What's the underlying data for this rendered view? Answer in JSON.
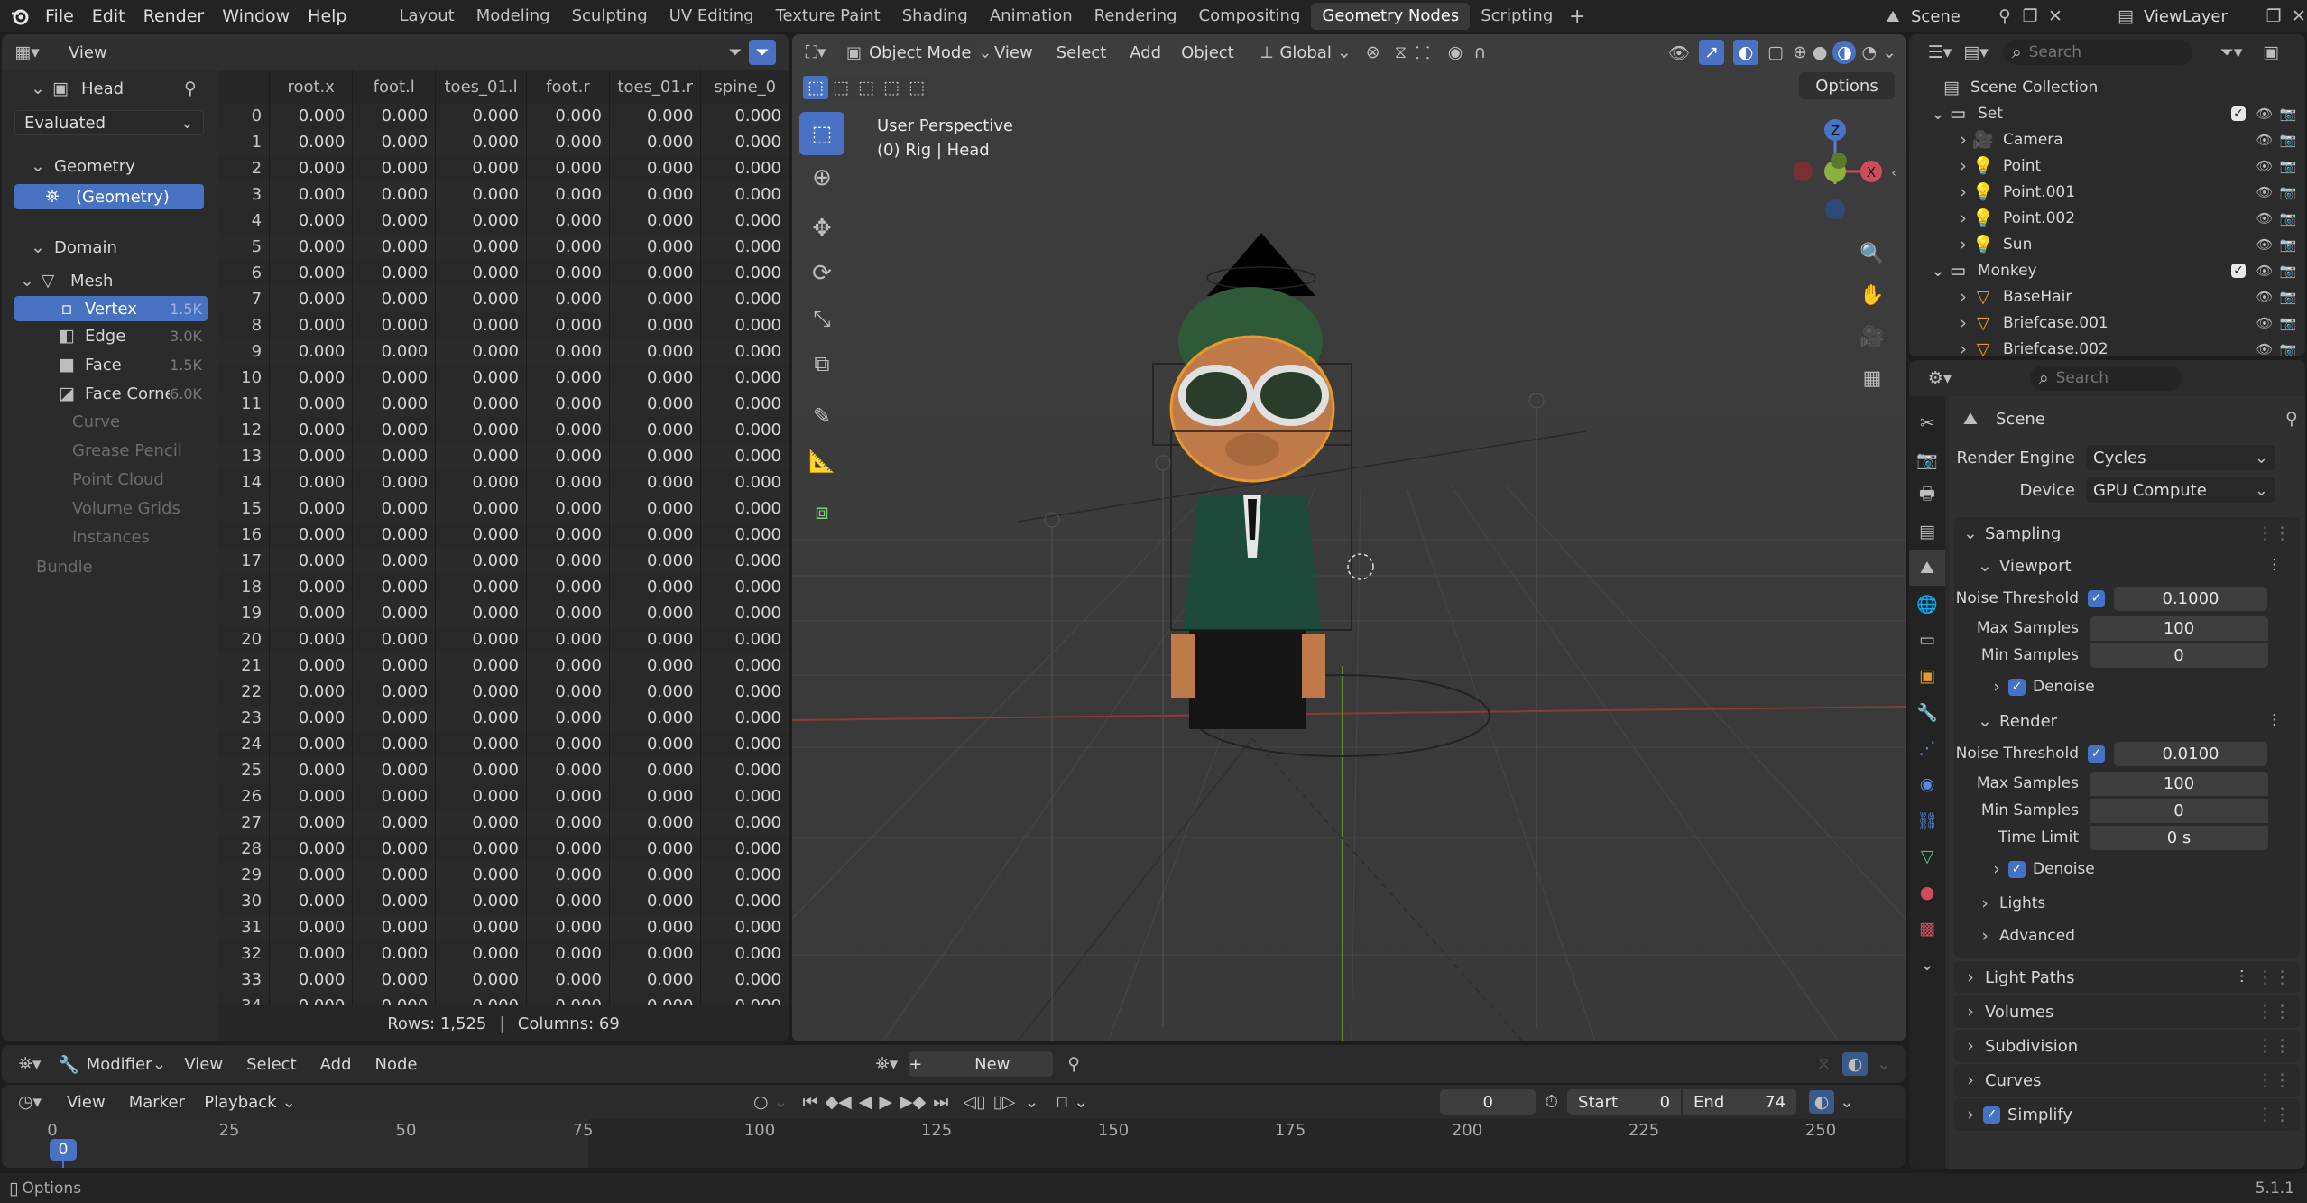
{
  "topbar": {
    "menus": [
      "File",
      "Edit",
      "Render",
      "Window",
      "Help"
    ],
    "workspaces": [
      "Layout",
      "Modeling",
      "Sculpting",
      "UV Editing",
      "Texture Paint",
      "Shading",
      "Animation",
      "Rendering",
      "Compositing",
      "Geometry Nodes",
      "Scripting"
    ],
    "active_workspace": "Geometry Nodes",
    "scene": "Scene",
    "view_layer": "ViewLayer"
  },
  "spreadsheet": {
    "header_view": "View",
    "object_name": "Head",
    "evaluated": "Evaluated",
    "geometry_label": "Geometry",
    "geometry_item": "(Geometry)",
    "domain_label": "Domain",
    "mesh_label": "Mesh",
    "domains": [
      {
        "name": "Vertex",
        "count": "1.5K"
      },
      {
        "name": "Edge",
        "count": "3.0K"
      },
      {
        "name": "Face",
        "count": "1.5K"
      },
      {
        "name": "Face Corner",
        "count": "6.0K"
      }
    ],
    "other_types": [
      "Curve",
      "Grease Pencil",
      "Point Cloud",
      "Volume Grids",
      "Instances"
    ],
    "bundle": "Bundle",
    "columns": [
      "root.x",
      "foot.l",
      "toes_01.l",
      "foot.r",
      "toes_01.r",
      "spine_0"
    ],
    "cell_value": "0.000",
    "row_indices": [
      "0",
      "1",
      "2",
      "3",
      "4",
      "5",
      "6",
      "7",
      "8",
      "9",
      "10",
      "11",
      "12",
      "13",
      "14",
      "15",
      "16",
      "17",
      "18",
      "19",
      "20",
      "21",
      "22",
      "23",
      "24",
      "25",
      "26",
      "27",
      "28",
      "29",
      "30",
      "31",
      "32",
      "33",
      "34"
    ],
    "rows_label": "Rows: 1,525",
    "columns_label": "Columns: 69"
  },
  "viewport": {
    "mode": "Object Mode",
    "menus": [
      "View",
      "Select",
      "Add",
      "Object"
    ],
    "transform": "Global",
    "options": "Options",
    "perspective": "User Perspective",
    "context": "(0) Rig | Head",
    "gizmo_z": "Z",
    "gizmo_x": "X"
  },
  "outliner": {
    "search_placeholder": "Search",
    "root": "Scene Collection",
    "items": [
      {
        "name": "Set",
        "level": 1,
        "type": "collection"
      },
      {
        "name": "Camera",
        "level": 2,
        "type": "camera"
      },
      {
        "name": "Point",
        "level": 2,
        "type": "light"
      },
      {
        "name": "Point.001",
        "level": 2,
        "type": "light"
      },
      {
        "name": "Point.002",
        "level": 2,
        "type": "light"
      },
      {
        "name": "Sun",
        "level": 2,
        "type": "light"
      },
      {
        "name": "Monkey",
        "level": 1,
        "type": "collection"
      },
      {
        "name": "BaseHair",
        "level": 2,
        "type": "mesh"
      },
      {
        "name": "Briefcase.001",
        "level": 2,
        "type": "mesh"
      },
      {
        "name": "Briefcase.002",
        "level": 2,
        "type": "mesh"
      }
    ]
  },
  "properties": {
    "search_placeholder": "Search",
    "scene": "Scene",
    "render_engine_label": "Render Engine",
    "render_engine": "Cycles",
    "device_label": "Device",
    "device": "GPU Compute",
    "sampling": "Sampling",
    "viewport": {
      "title": "Viewport",
      "noise_threshold_label": "Noise Threshold",
      "noise_threshold": "0.1000",
      "max_samples_label": "Max Samples",
      "max_samples": "100",
      "min_samples_label": "Min Samples",
      "min_samples": "0",
      "denoise": "Denoise"
    },
    "render": {
      "title": "Render",
      "noise_threshold_label": "Noise Threshold",
      "noise_threshold": "0.0100",
      "max_samples_label": "Max Samples",
      "max_samples": "100",
      "min_samples_label": "Min Samples",
      "min_samples": "0",
      "time_limit_label": "Time Limit",
      "time_limit": "0 s",
      "denoise": "Denoise"
    },
    "sub_panels": [
      "Lights",
      "Advanced"
    ],
    "panels": [
      "Light Paths",
      "Volumes",
      "Subdivision",
      "Curves",
      "Simplify"
    ]
  },
  "node_editor": {
    "editor": "Modifier",
    "menus": [
      "View",
      "Select",
      "Add",
      "Node"
    ],
    "new_button": "New"
  },
  "timeline": {
    "menus": [
      "View",
      "Marker",
      "Playback"
    ],
    "current_frame": "0",
    "start_label": "Start",
    "start": "0",
    "end_label": "End",
    "end": "74",
    "ticks": [
      "0",
      "25",
      "50",
      "75",
      "100",
      "125",
      "150",
      "175",
      "200",
      "225",
      "250"
    ]
  },
  "statusbar": {
    "left": "Options",
    "version": "5.1.1"
  }
}
